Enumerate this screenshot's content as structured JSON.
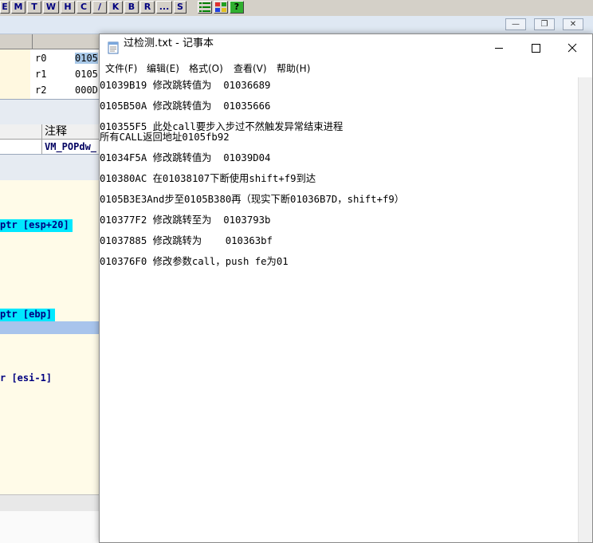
{
  "debugger": {
    "toolbar": {
      "buttons": [
        "E",
        "M",
        "T",
        "W",
        "H",
        "C",
        "/",
        "K",
        "B",
        "R",
        "...",
        "S"
      ],
      "icon_buttons": [
        "list-icon",
        "grid-icon",
        "help-icon"
      ],
      "help_label": "?"
    },
    "mdi_controls": [
      "minimize-icon",
      "restore-icon",
      "close-icon"
    ],
    "registers": [
      {
        "name": "r0",
        "value": "0105"
      },
      {
        "name": "r1",
        "value": "0105"
      },
      {
        "name": "r2",
        "value": "000D"
      }
    ],
    "columns": {
      "comment_header": "注释"
    },
    "comment_row": "VM_POPdw_",
    "code_lines": [
      {
        "text": "ptr [esp+20]",
        "style": "highlight"
      },
      {
        "text": "ptr [ebp]",
        "style": "highlight"
      },
      {
        "text": "",
        "style": "selected"
      },
      {
        "text": "r [esi-1]",
        "style": "plain"
      }
    ],
    "colors": {
      "accent_cyan": "#00e8ff",
      "code_text": "#000080",
      "selected_row": "#a8c4ec"
    }
  },
  "notepad": {
    "title": "过检测.txt - 记事本",
    "caption_buttons": [
      "minimize-icon",
      "maximize-icon",
      "close-icon"
    ],
    "menu": [
      "文件(F)",
      "编辑(E)",
      "格式(O)",
      "查看(V)",
      "帮助(H)"
    ],
    "lines": [
      "01039B19 修改跳转值为  01036689",
      "0105B50A 修改跳转值为  01035666",
      "010355F5 此处call要步入步过不然触发异常结束进程",
      "所有CALL返回地址0105fb92",
      "01034F5A 修改跳转值为  01039D04",
      "010380AC 在01038107下断使用shift+f9到达",
      "0105B3E3And步至0105B380再（现实下断01036B7D，shift+f9）",
      "010377F2 修改跳转至为  0103793b",
      "01037885 修改跳转为    010363bf",
      "010376F0 修改参数call，push fe为01"
    ]
  }
}
